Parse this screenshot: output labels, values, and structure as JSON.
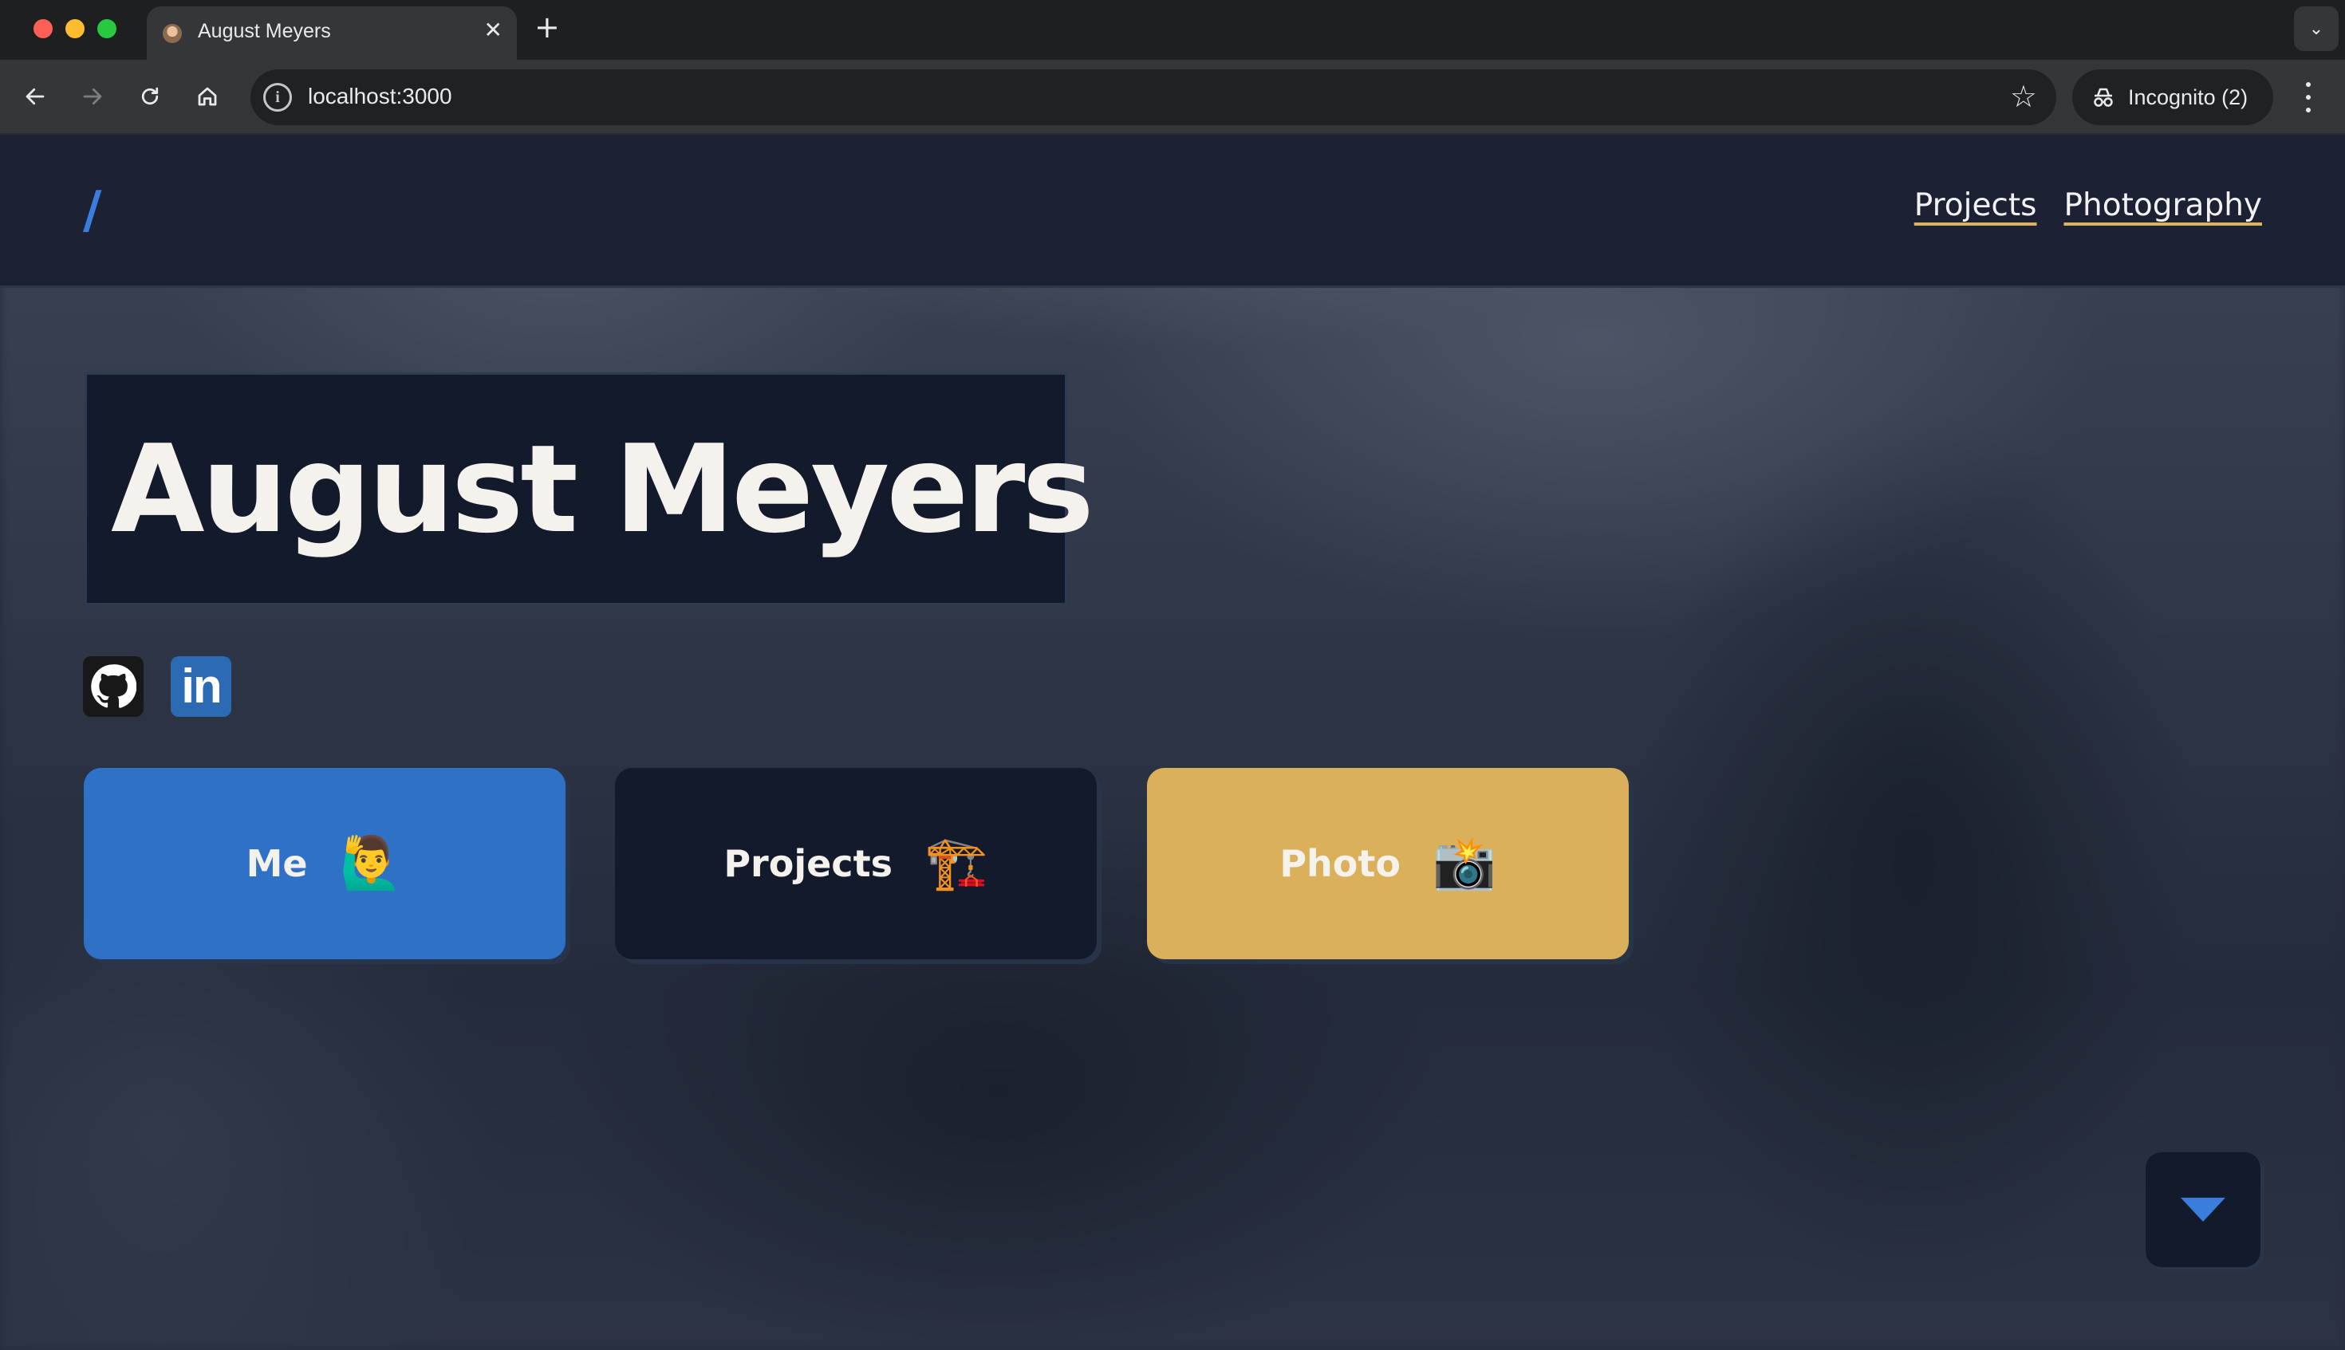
{
  "browser": {
    "tab": {
      "title": "August Meyers",
      "close_glyph": "✕"
    },
    "new_tab_glyph": "+",
    "tab_menu_glyph": "⌄",
    "address": "localhost:3000",
    "incognito_label": "Incognito (2)",
    "icons": [
      "back-arrow-icon",
      "forward-arrow-icon",
      "reload-icon",
      "home-icon",
      "site-info-icon",
      "star-icon",
      "incognito-icon",
      "kebab-menu-icon"
    ]
  },
  "site": {
    "logo": "/",
    "nav": [
      {
        "label": "Projects"
      },
      {
        "label": "Photography"
      }
    ],
    "hero_title": "August Meyers",
    "social": [
      {
        "name": "GitHub",
        "icon": "github-icon"
      },
      {
        "name": "LinkedIn",
        "icon": "linkedin-icon",
        "glyph": "in"
      }
    ],
    "cards": [
      {
        "label": "Me",
        "emoji": "🙋‍♂️",
        "color": "#3071c8"
      },
      {
        "label": "Projects",
        "emoji": "🏗️",
        "color": "#131a2b"
      },
      {
        "label": "Photo",
        "emoji": "📸",
        "color": "#dbb05a"
      }
    ],
    "scroll_button_icon": "caret-down-icon",
    "colors": {
      "accent_blue": "#3b7ddd",
      "accent_gold": "#e0b25c",
      "dark_panel": "#131a2b"
    }
  }
}
